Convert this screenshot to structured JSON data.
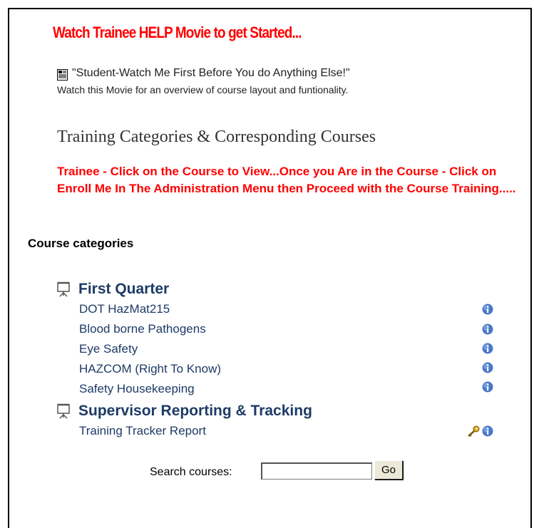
{
  "help": {
    "title": "Watch Trainee HELP Movie to get Started...",
    "movie_link": "\"Student-Watch Me First Before You do Anything Else!\"",
    "movie_description": "Watch this Movie for an overview of course layout and funtionality."
  },
  "training": {
    "title": "Training Categories & Corresponding Courses",
    "instructions": "Trainee - Click on the Course to View...Once you Are in the Course - Click on Enroll Me In The Administration Menu then Proceed with the Course Training....."
  },
  "categories": {
    "heading": "Course categories",
    "items": [
      {
        "name": "First Quarter",
        "courses": [
          {
            "name": "DOT HazMat215",
            "icons": [
              "info-icon"
            ]
          },
          {
            "name": "Blood borne Pathogens",
            "icons": [
              "info-icon"
            ]
          },
          {
            "name": "Eye Safety",
            "icons": [
              "info-icon"
            ]
          },
          {
            "name": "HAZCOM (Right To Know)",
            "icons": [
              "info-icon"
            ]
          },
          {
            "name": "Safety Housekeeping",
            "icons": [
              "info-icon"
            ]
          }
        ]
      },
      {
        "name": "Supervisor Reporting & Tracking",
        "courses": [
          {
            "name": "Training Tracker Report",
            "icons": [
              "key-icon",
              "info-icon"
            ]
          }
        ]
      }
    ]
  },
  "search": {
    "label": "Search courses:",
    "value": "",
    "button_label": "Go"
  },
  "colors": {
    "alert_red": "#ff0000",
    "link_blue": "#1d3b66",
    "info_blue": "#4a78c8"
  }
}
